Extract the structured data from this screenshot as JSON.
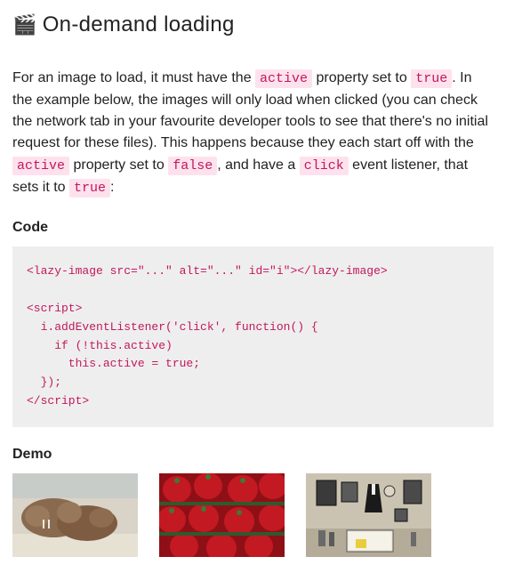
{
  "header": {
    "emoji": "🎬",
    "title": "On-demand loading"
  },
  "intro": {
    "p1a": "For an image to load, it must have the ",
    "code1": "active",
    "p1b": " property set to ",
    "code2": "true",
    "p1c": ". In the example below, the images will only load when clicked (you can check the network tab in your favourite developer tools to see that there's no initial request for these files). This happens because they each start off with the ",
    "code3": "active",
    "p1d": " property set to ",
    "code4": "false",
    "p1e": ", and have a ",
    "code5": "click",
    "p1f": " event listener, that sets it to ",
    "code6": "true",
    "p1g": ":"
  },
  "sections": {
    "code_heading": "Code",
    "demo_heading": "Demo"
  },
  "codeblock": "<lazy-image src=\"...\" alt=\"...\" id=\"i\"></lazy-image>\n\n<script>\n  i.addEventListener('click', function() {\n    if (!this.active)\n      this.active = true;\n  });\n</script>",
  "demo": {
    "images": [
      {
        "name": "walruses-thumb",
        "alt": "walruses on beach"
      },
      {
        "name": "strawberries-thumb",
        "alt": "strawberries"
      },
      {
        "name": "shop-interior-thumb",
        "alt": "shop interior"
      }
    ]
  }
}
